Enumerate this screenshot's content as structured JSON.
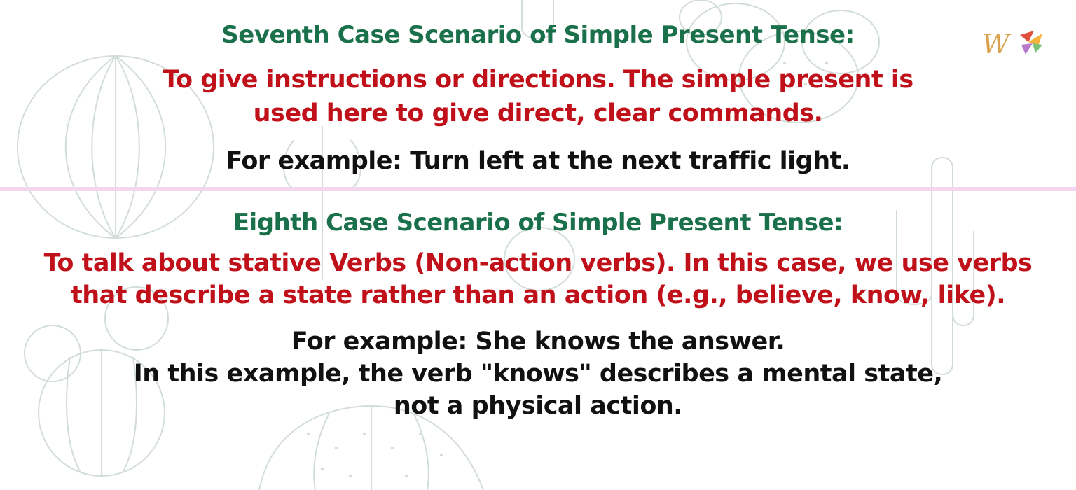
{
  "section7": {
    "heading": "Seventh Case Scenario of Simple Present Tense:",
    "description_lines": [
      "To give instructions or directions. The simple present is",
      "used here to give direct, clear commands."
    ],
    "example": "For example: Turn left at the next traffic light."
  },
  "section8": {
    "heading": "Eighth Case Scenario of Simple Present Tense:",
    "description_lines": [
      "To talk about stative Verbs (Non-action verbs). In this case, we use verbs",
      "that describe a state rather than an action (e.g., believe, know, like)."
    ],
    "example_lines": [
      "For example: She knows the answer.",
      "In this example, the verb \"knows\" describes a mental state,",
      "not a physical action."
    ]
  },
  "logo": {
    "letter": "W"
  },
  "colors": {
    "heading": "#19704a",
    "description": "#c0111a",
    "example": "#111111",
    "divider": "#f3d6ef",
    "background_art": "#c9d6cf"
  },
  "background": {
    "icon": "cactus-illustration-icon"
  }
}
